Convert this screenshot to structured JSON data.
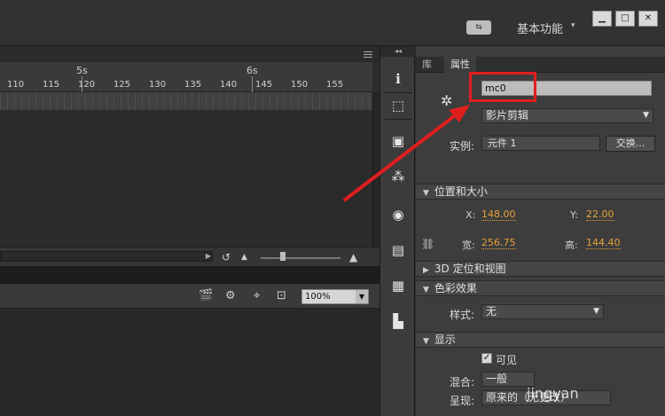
{
  "topbar": {
    "sync_icon": "sync-settings-icon",
    "workspace": "基本功能",
    "minimize": "▁",
    "maximize": "□",
    "close": "✕"
  },
  "timeline": {
    "seconds": [
      "5s",
      "6s"
    ],
    "frames": [
      "110",
      "115",
      "120",
      "125",
      "130",
      "135",
      "140",
      "145",
      "150",
      "155"
    ]
  },
  "stage": {
    "zoom": "100%"
  },
  "dock": {
    "icons": [
      "info-icon",
      "transform-icon",
      "library-icon",
      "motion-presets-icon",
      "color-icon",
      "align-icon",
      "components-icon",
      "distribute-icon"
    ]
  },
  "properties": {
    "tabs": [
      "库",
      "属性"
    ],
    "instance_name": "mc0",
    "symbol_type": "影片剪辑",
    "instance_label": "实例:",
    "instance_value": "元件 1",
    "swap_button": "交换...",
    "sections": {
      "position_size": "位置和大小",
      "position_3d": "3D 定位和视图",
      "color_effect": "色彩效果",
      "display": "显示"
    },
    "x_label": "X:",
    "x_value": "148.00",
    "y_label": "Y:",
    "y_value": "22.00",
    "w_label": "宽:",
    "w_value": "256.75",
    "h_label": "高:",
    "h_value": "144.40",
    "style_label": "样式:",
    "style_value": "无",
    "visible_label": "可见",
    "blend_label": "混合:",
    "blend_value": "一般",
    "render_label": "呈现:",
    "render_value": "原来的（无更改）"
  },
  "watermark": "jingyan",
  "colors": {
    "highlight": "#e01e1e",
    "value_orange": "#e8a13a"
  }
}
